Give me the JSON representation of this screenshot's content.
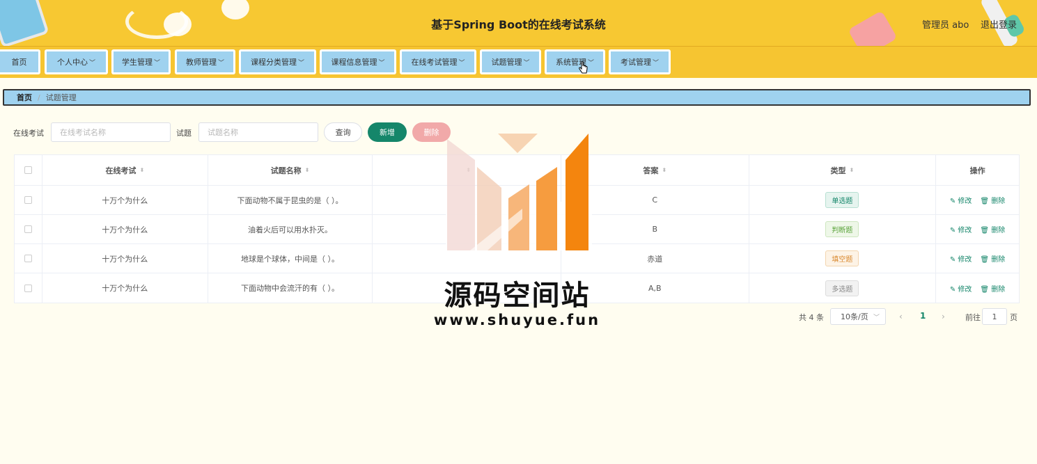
{
  "header": {
    "title": "基于Spring Boot的在线考试系统",
    "user_label": "管理员 abo",
    "logout_label": "退出登录"
  },
  "nav": {
    "items": [
      "首页",
      "个人中心",
      "学生管理",
      "教师管理",
      "课程分类管理",
      "课程信息管理",
      "在线考试管理",
      "试题管理",
      "系统管理",
      "考试管理"
    ]
  },
  "breadcrumb": {
    "home": "首页",
    "separator": "/",
    "current": "试题管理"
  },
  "search": {
    "exam_label": "在线考试",
    "exam_placeholder": "在线考试名称",
    "question_label": "试题",
    "question_placeholder": "试题名称",
    "query_button": "查询",
    "add_button": "新增",
    "delete_button": "删除"
  },
  "table": {
    "columns": [
      "在线考试",
      "试题名称",
      "",
      "答案",
      "类型",
      "操作"
    ],
    "rows": [
      {
        "exam": "十万个为什么",
        "question": "下面动物不属于昆虫的是（ ）。",
        "answer": "C",
        "type": "单选题"
      },
      {
        "exam": "十万个为什么",
        "question": "油着火后可以用水扑灭。",
        "answer": "B",
        "type": "判断题"
      },
      {
        "exam": "十万个为什么",
        "question": "地球是个球体，中间是（ ）。",
        "answer": "赤道",
        "type": "填空题"
      },
      {
        "exam": "十万个为什么",
        "question": "下面动物中会流汗的有（ ）。",
        "answer": "A,B",
        "type": "多选题"
      }
    ],
    "edit_label": "修改",
    "delete_label": "删除"
  },
  "pagination": {
    "total": "共 4 条",
    "page_size": "10条/页",
    "prev": "‹",
    "current_page": "1",
    "next": "›",
    "goto_label": "前往",
    "goto_value": "1",
    "page_suffix": "页"
  },
  "watermark": {
    "text": "源码空间站",
    "url": "www.shuyue.fun"
  },
  "colors": {
    "header_bg": "#f7c832",
    "nav_item_bg": "#9fd2ef",
    "primary": "#15866a",
    "danger_light": "#f1a9a9",
    "page_bg": "#fffdf0"
  }
}
